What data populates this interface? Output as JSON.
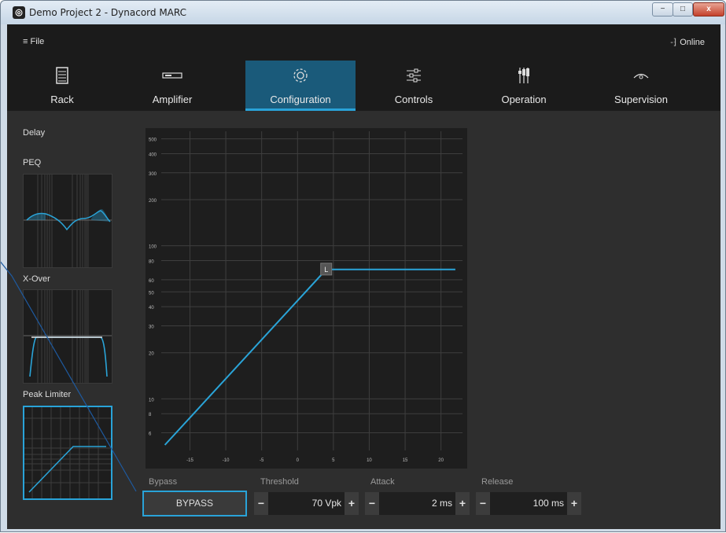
{
  "window": {
    "title": "Demo Project 2 - Dynacord MARC",
    "min_label": "−",
    "max_label": "□",
    "close_label": "x"
  },
  "topbar": {
    "file_label": "≡ File",
    "status_label": "Online"
  },
  "tabs": [
    {
      "label": "Rack",
      "icon": "rack-icon"
    },
    {
      "label": "Amplifier",
      "icon": "amplifier-icon"
    },
    {
      "label": "Configuration",
      "icon": "gear-icon",
      "active": true
    },
    {
      "label": "Controls",
      "icon": "sliders-icon"
    },
    {
      "label": "Operation",
      "icon": "operation-icon"
    },
    {
      "label": "Supervision",
      "icon": "eye-icon"
    }
  ],
  "sidebar": {
    "delay_label": "Delay",
    "peq_label": "PEQ",
    "xover_label": "X-Over",
    "limiter_label": "Peak Limiter"
  },
  "graph": {
    "y_ticks": [
      "500",
      "400",
      "300",
      "200",
      "100",
      "80",
      "60",
      "50",
      "40",
      "30",
      "20",
      "10",
      "8",
      "6"
    ],
    "x_ticks": [
      "-15",
      "-10",
      "-5",
      "0",
      "5",
      "10",
      "15",
      "20"
    ],
    "marker_label": "L",
    "line_color": "#2aa4d8"
  },
  "chart_data": {
    "type": "line",
    "x_scale": "linear",
    "y_scale": "log",
    "xlim": [
      -19,
      23
    ],
    "ylim": [
      4.6,
      560
    ],
    "x": [
      -18.5,
      4,
      22
    ],
    "y": [
      5,
      70,
      70
    ],
    "annotations": [
      {
        "x": 4,
        "y": 70,
        "text": "L"
      }
    ]
  },
  "controls": {
    "bypass": {
      "label": "Bypass",
      "button": "BYPASS"
    },
    "threshold": {
      "label": "Threshold",
      "value": "70 Vpk"
    },
    "attack": {
      "label": "Attack",
      "value": "2 ms"
    },
    "release": {
      "label": "Release",
      "value": "100 ms"
    },
    "minus": "−",
    "plus": "+"
  },
  "accent_color": "#29a3d8"
}
